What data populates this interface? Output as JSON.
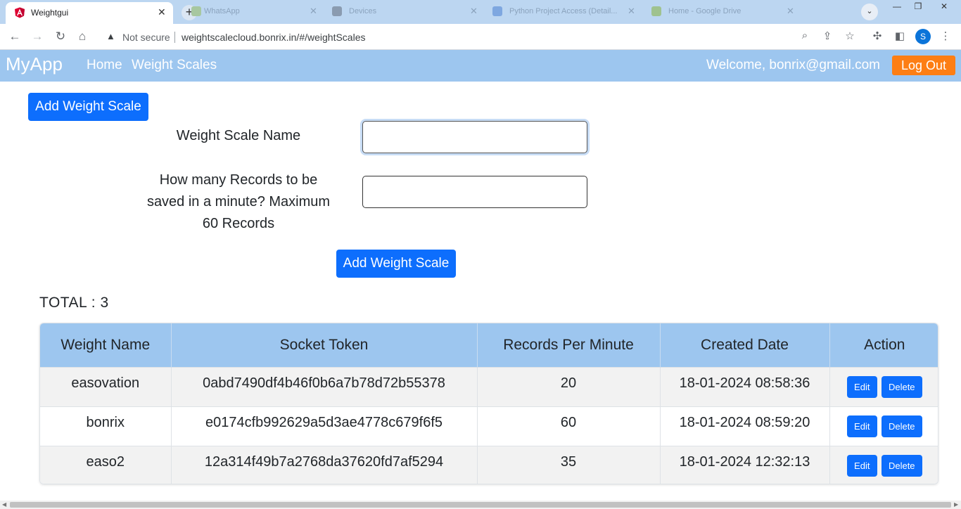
{
  "browser": {
    "active_tab": {
      "title": "Weightgui"
    },
    "background_tabs": [
      {
        "title": "WhatsApp"
      },
      {
        "title": "Devices"
      },
      {
        "title": "Python Project Access (Detail..."
      },
      {
        "title": "Home - Google Drive"
      }
    ],
    "address": {
      "security_label": "Not secure",
      "url": "weightscalecloud.bonrix.in/#/weightScales"
    },
    "profile_initial": "S"
  },
  "navbar": {
    "brand": "MyApp",
    "links": [
      "Home",
      "Weight Scales"
    ],
    "welcome": "Welcome, bonrix@gmail.com",
    "logout_label": "Log Out"
  },
  "form": {
    "toggle_button_label": "Add Weight Scale",
    "name_label": "Weight Scale Name",
    "name_value": "",
    "records_label": "How many Records to be saved in a minute? Maximum 60 Records",
    "records_value": "",
    "submit_label": "Add Weight Scale"
  },
  "total_label": "TOTAL : 3",
  "table": {
    "headers": [
      "Weight Name",
      "Socket Token",
      "Records Per Minute",
      "Created Date",
      "Action"
    ],
    "rows": [
      {
        "name": "easovation",
        "token": "0abd7490df4b46f0b6a7b78d72b55378",
        "rpm": "20",
        "created": "18-01-2024 08:58:36"
      },
      {
        "name": "bonrix",
        "token": "e0174cfb992629a5d3ae4778c679f6f5",
        "rpm": "60",
        "created": "18-01-2024 08:59:20"
      },
      {
        "name": "easo2",
        "token": "12a314f49b7a2768da37620fd7af5294",
        "rpm": "35",
        "created": "18-01-2024 12:32:13"
      }
    ],
    "edit_label": "Edit",
    "delete_label": "Delete"
  },
  "colors": {
    "navbar": "#9dc6ef",
    "primary": "#0d6efd",
    "logout": "#fd7e14"
  }
}
